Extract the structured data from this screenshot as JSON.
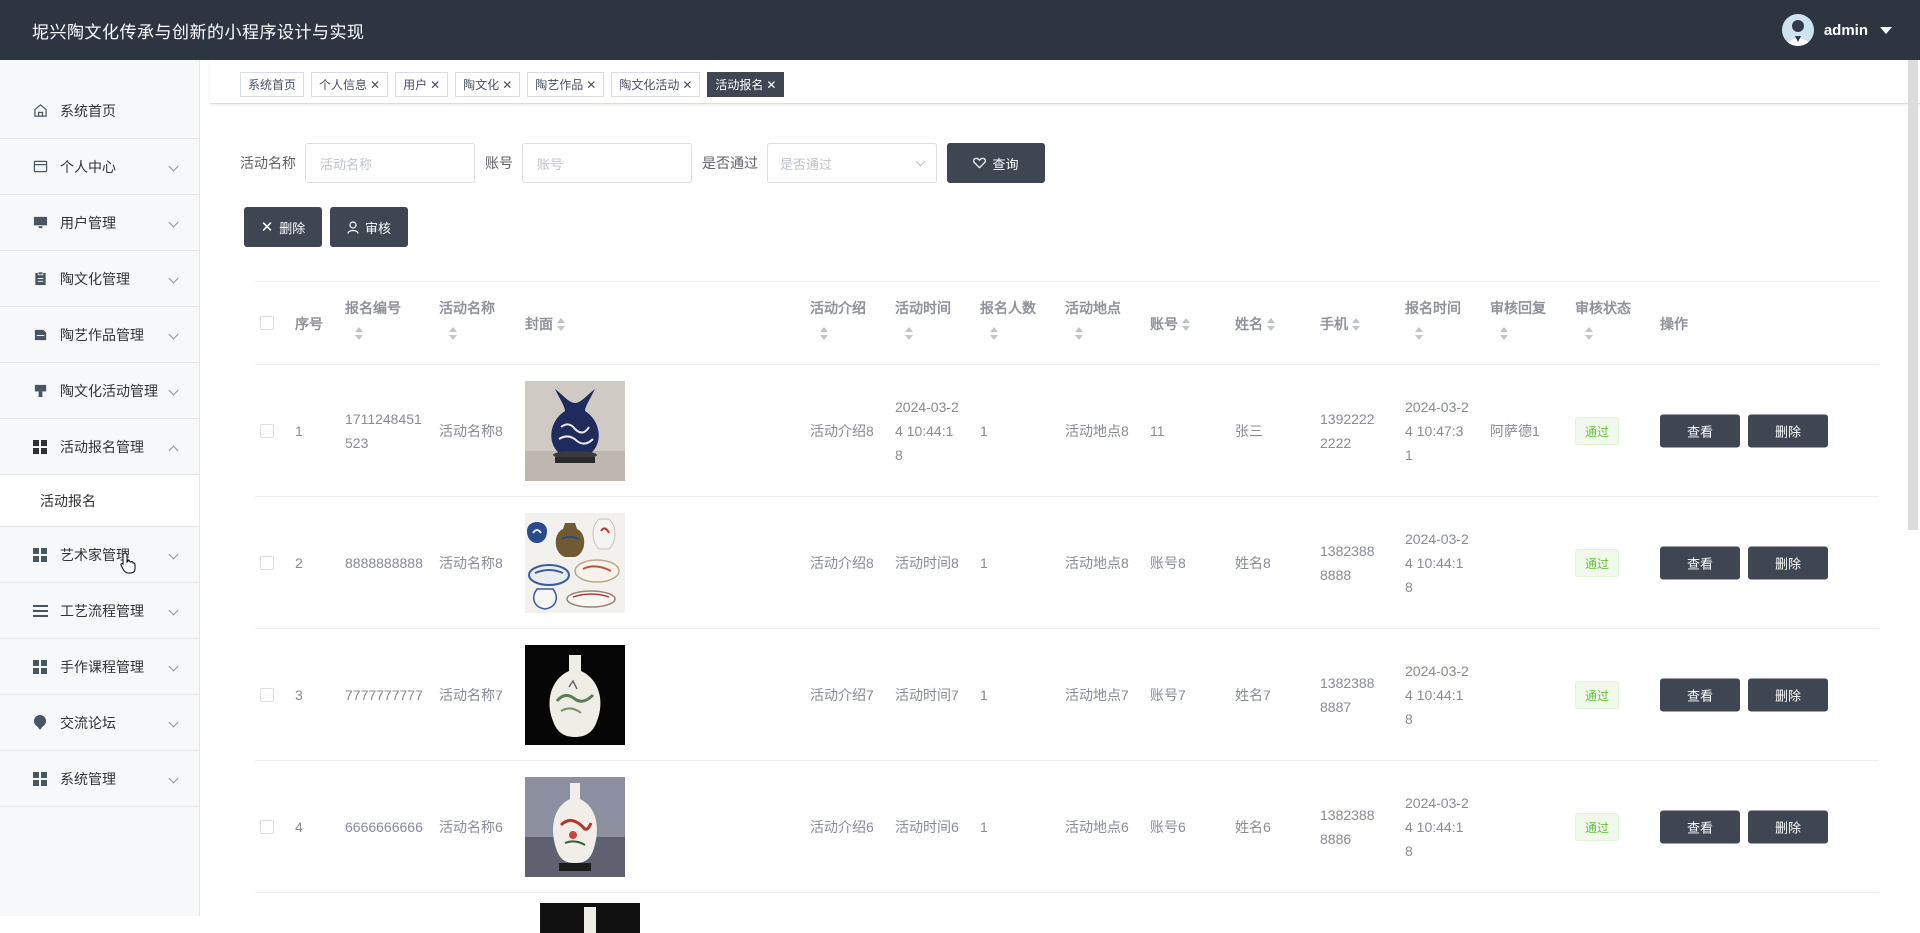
{
  "app": {
    "title": "坭兴陶文化传承与创新的小程序设计与实现",
    "user": "admin"
  },
  "sidebar": {
    "items": [
      {
        "label": "系统首页",
        "icon": "home-icon",
        "expandable": false
      },
      {
        "label": "个人中心",
        "icon": "profile-card-icon",
        "expandable": true
      },
      {
        "label": "用户管理",
        "icon": "monitor-icon",
        "expandable": true
      },
      {
        "label": "陶文化管理",
        "icon": "clipboard-icon",
        "expandable": true
      },
      {
        "label": "陶艺作品管理",
        "icon": "document-icon",
        "expandable": true
      },
      {
        "label": "陶文化活动管理",
        "icon": "shield-icon",
        "expandable": true
      },
      {
        "label": "活动报名管理",
        "icon": "grid-icon",
        "expandable": true,
        "expanded": true,
        "children": [
          "活动报名"
        ]
      },
      {
        "label": "艺术家管理",
        "icon": "grid-icon",
        "expandable": true
      },
      {
        "label": "工艺流程管理",
        "icon": "list-icon",
        "expandable": true
      },
      {
        "label": "手作课程管理",
        "icon": "grid-icon",
        "expandable": true
      },
      {
        "label": "交流论坛",
        "icon": "pin-icon",
        "expandable": true
      },
      {
        "label": "系统管理",
        "icon": "grid-icon",
        "expandable": true
      }
    ]
  },
  "tabs": [
    {
      "label": "系统首页",
      "closable": false,
      "active": false
    },
    {
      "label": "个人信息",
      "closable": true,
      "active": false
    },
    {
      "label": "用户",
      "closable": true,
      "active": false
    },
    {
      "label": "陶文化",
      "closable": true,
      "active": false
    },
    {
      "label": "陶艺作品",
      "closable": true,
      "active": false
    },
    {
      "label": "陶文化活动",
      "closable": true,
      "active": false
    },
    {
      "label": "活动报名",
      "closable": true,
      "active": true
    }
  ],
  "search": {
    "activity_name_label": "活动名称",
    "activity_name_placeholder": "活动名称",
    "account_label": "账号",
    "account_placeholder": "账号",
    "passed_label": "是否通过",
    "passed_placeholder": "是否通过",
    "query_button": "查询"
  },
  "actions": {
    "delete_button": "删除",
    "review_button": "审核"
  },
  "table": {
    "columns": [
      "序号",
      "报名编号",
      "活动名称",
      "封面",
      "活动介绍",
      "活动时间",
      "报名人数",
      "活动地点",
      "账号",
      "姓名",
      "手机",
      "报名时间",
      "审核回复",
      "审核状态",
      "操作"
    ],
    "rows": [
      {
        "index": "1",
        "reg_no": "1711248451523",
        "name": "活动名称8",
        "cover": "blue-white-vase",
        "intro": "活动介绍8",
        "time": "2024-03-24 10:44:18",
        "count": "1",
        "place": "活动地点8",
        "account": "11",
        "person": "张三",
        "phone": "13922222222",
        "reg_time": "2024-03-24 10:47:31",
        "reply": "阿萨德1",
        "status": "通过"
      },
      {
        "index": "2",
        "reg_no": "8888888888",
        "name": "活动名称8",
        "cover": "ceramics-set",
        "intro": "活动介绍8",
        "time": "活动时间8",
        "count": "1",
        "place": "活动地点8",
        "account": "账号8",
        "person": "姓名8",
        "phone": "13823888888",
        "reg_time": "2024-03-24 10:44:18",
        "reply": "",
        "status": "通过"
      },
      {
        "index": "3",
        "reg_no": "7777777777",
        "name": "活动名称7",
        "cover": "white-landscape-vase",
        "intro": "活动介绍7",
        "time": "活动时间7",
        "count": "1",
        "place": "活动地点7",
        "account": "账号7",
        "person": "姓名7",
        "phone": "13823888887",
        "reg_time": "2024-03-24 10:44:18",
        "reply": "",
        "status": "通过"
      },
      {
        "index": "4",
        "reg_no": "6666666666",
        "name": "活动名称6",
        "cover": "red-bird-vase",
        "intro": "活动介绍6",
        "time": "活动时间6",
        "count": "1",
        "place": "活动地点6",
        "account": "账号6",
        "person": "姓名6",
        "phone": "13823888886",
        "reg_time": "2024-03-24 10:44:18",
        "reply": "",
        "status": "通过"
      }
    ],
    "view_button": "查看",
    "delete_button": "删除"
  },
  "colors": {
    "topbar": "#2d3640",
    "button_dark": "#3f4651",
    "badge_green": "#67c23a"
  }
}
